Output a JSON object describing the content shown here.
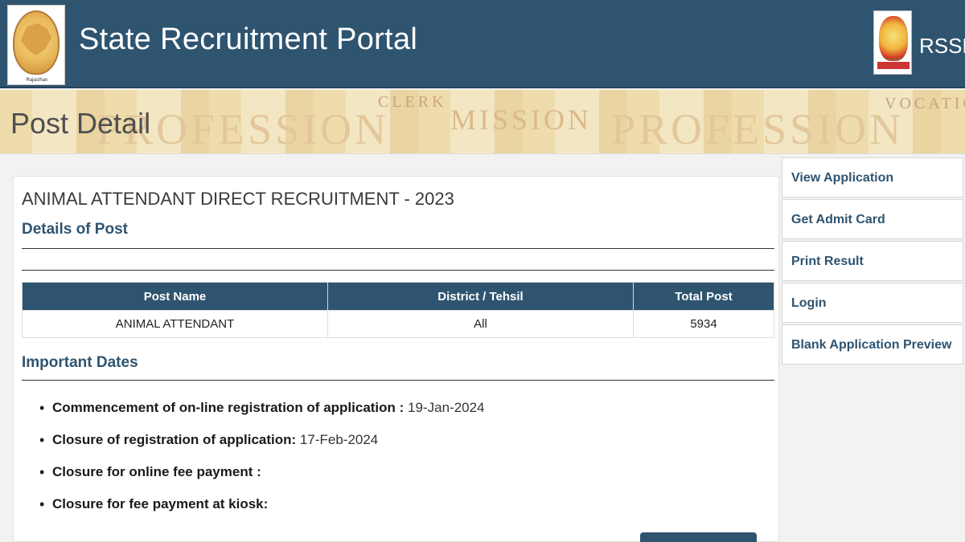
{
  "header": {
    "title": "State Recruitment Portal",
    "left_logo_caption": "Rajasthan",
    "right_label": "RSSB",
    "background_color": "#2f5470"
  },
  "banner": {
    "page_title": "Post Detail",
    "watermark_words": [
      "PROFESSION",
      "MISSION",
      "CLERK",
      "PROFESSION",
      "VOCATION"
    ]
  },
  "post": {
    "title": "ANIMAL ATTENDANT DIRECT RECRUITMENT - 2023",
    "details_heading": "Details of Post",
    "table": {
      "headers": [
        "Post Name",
        "District / Tehsil",
        "Total Post"
      ],
      "rows": [
        [
          "ANIMAL ATTENDANT",
          "All",
          "5934"
        ]
      ]
    },
    "important_dates_heading": "Important Dates",
    "dates": [
      {
        "label": "Commencement of on-line registration of application :",
        "value": "19-Jan-2024"
      },
      {
        "label": "Closure of registration of application:",
        "value": "17-Feb-2024"
      },
      {
        "label": "Closure for online fee payment :",
        "value": ""
      },
      {
        "label": "Closure for fee payment at kiosk:",
        "value": ""
      }
    ]
  },
  "sidebar": {
    "items": [
      {
        "label": "View Application"
      },
      {
        "label": "Get Admit Card"
      },
      {
        "label": "Print Result"
      },
      {
        "label": "Login"
      },
      {
        "label": "Blank Application Preview"
      }
    ]
  }
}
